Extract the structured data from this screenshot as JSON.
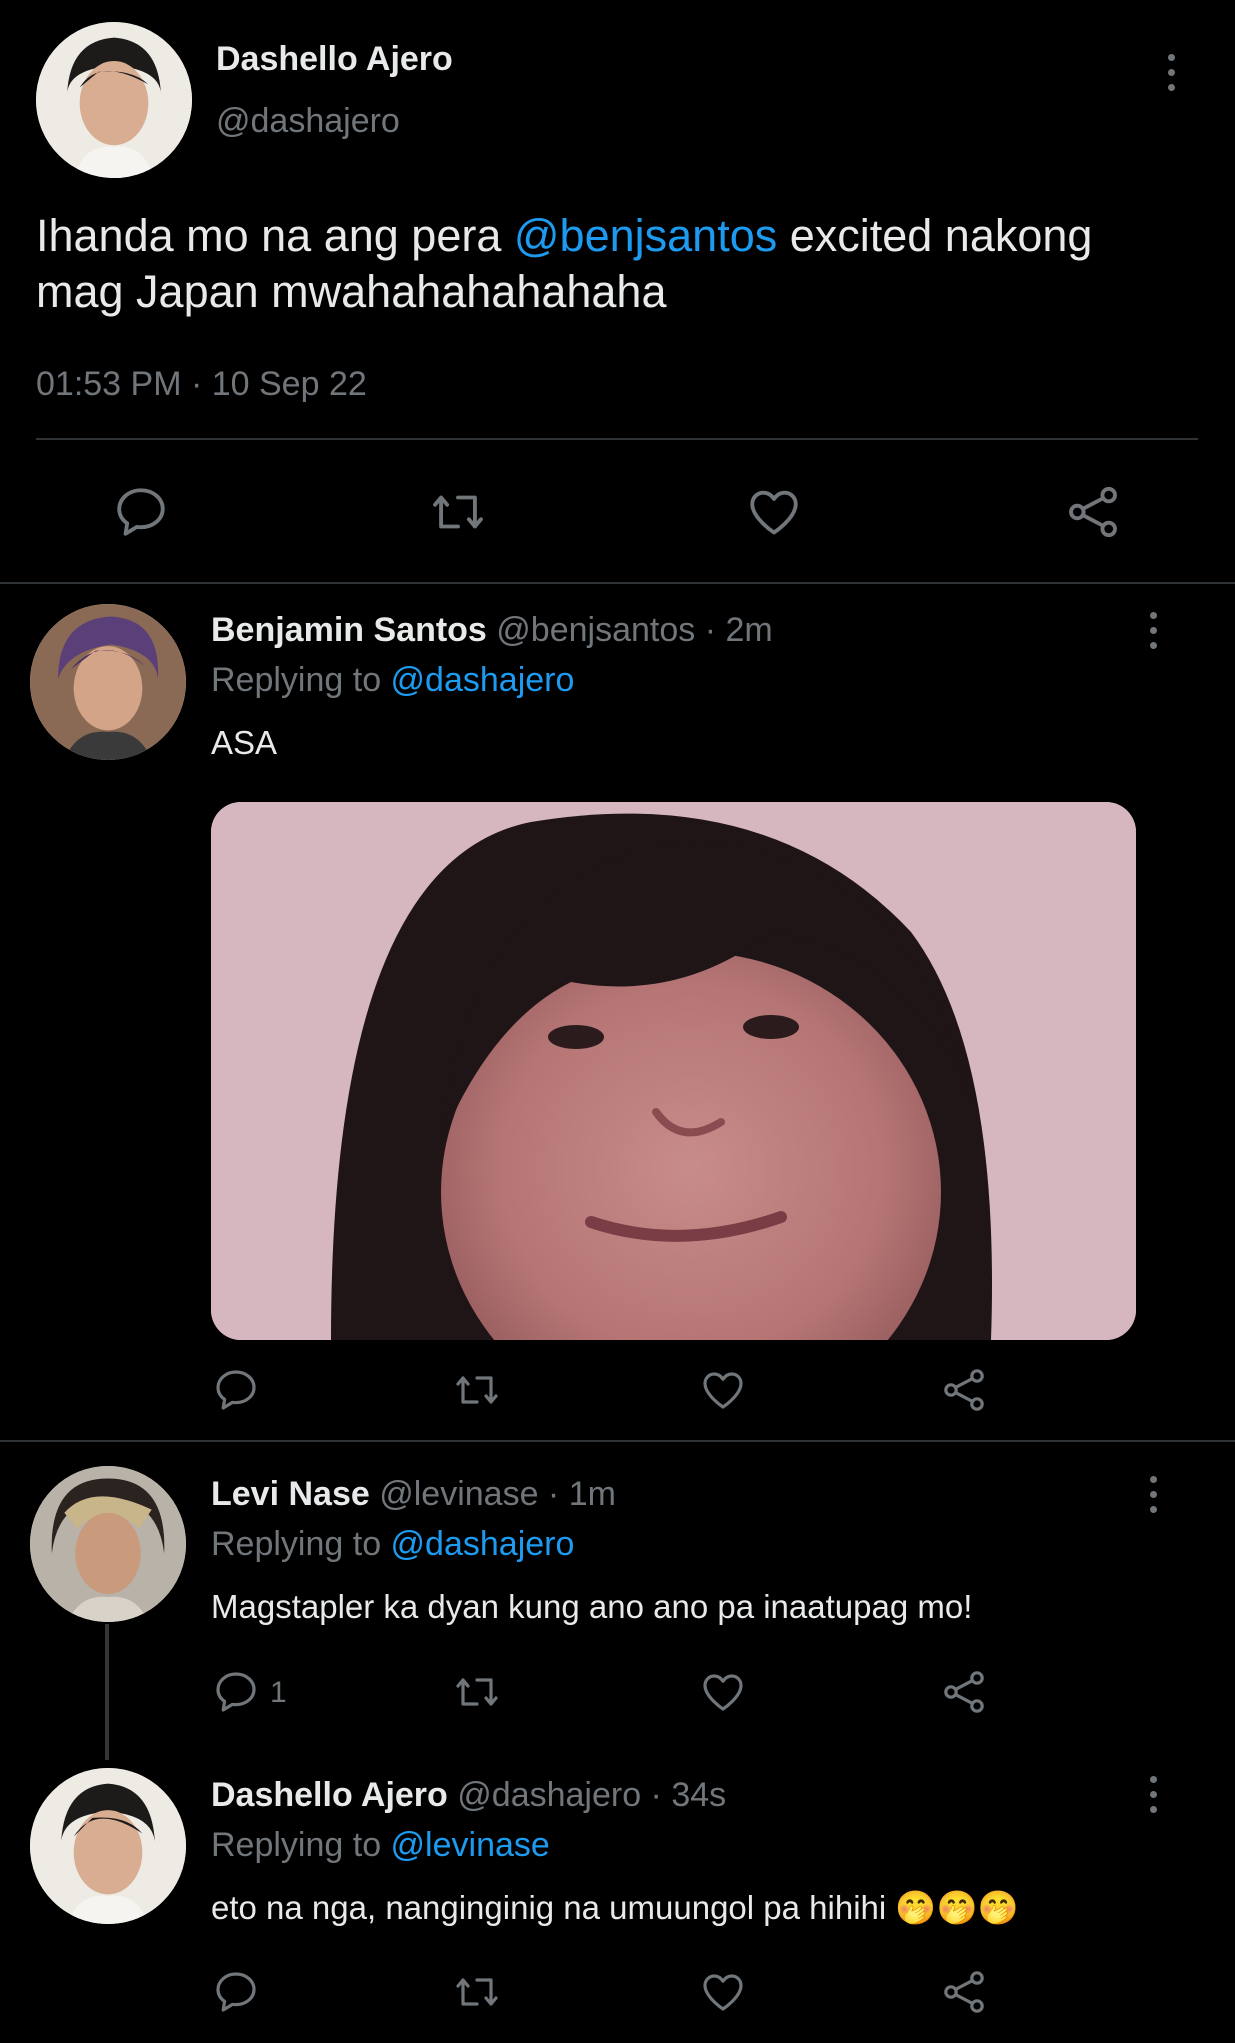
{
  "main_tweet": {
    "author_name": "Dashello Ajero",
    "author_handle": "@dashajero",
    "text_before": "Ihanda mo na ang pera ",
    "mention": "@benjsantos",
    "text_after_line1": " excited nakong",
    "text_line2": "mag Japan mwahahahahahaha",
    "timestamp": "01:53 PM · 10 Sep 22",
    "actions": [
      "reply-icon",
      "retweet-icon",
      "like-icon",
      "share-icon"
    ]
  },
  "replies": [
    {
      "author_name": "Benjamin Santos",
      "meta": "@benjsantos · 2m",
      "replying_prefix": "Replying to ",
      "replying_to": "@dashajero",
      "text": "ASA",
      "has_image": true,
      "reply_count": ""
    },
    {
      "author_name": "Levi Nase",
      "meta": "@levinase · 1m",
      "replying_prefix": "Replying to ",
      "replying_to": "@dashajero",
      "text": "Magstapler ka dyan kung ano ano pa inaatupag mo!",
      "reply_count": "1"
    },
    {
      "author_name": "Dashello Ajero",
      "meta": "@dashajero · 34s",
      "replying_prefix": "Replying to ",
      "replying_to": "@levinase",
      "text": "eto na nga, nanginginig na umuungol pa hihihi",
      "emoji": "🤭🤭🤭",
      "reply_count": ""
    }
  ],
  "colors": {
    "background": "#000000",
    "text": "#e7e9ea",
    "secondary": "#71767b",
    "accent": "#1d9bf0",
    "divider": "#2f3336"
  }
}
